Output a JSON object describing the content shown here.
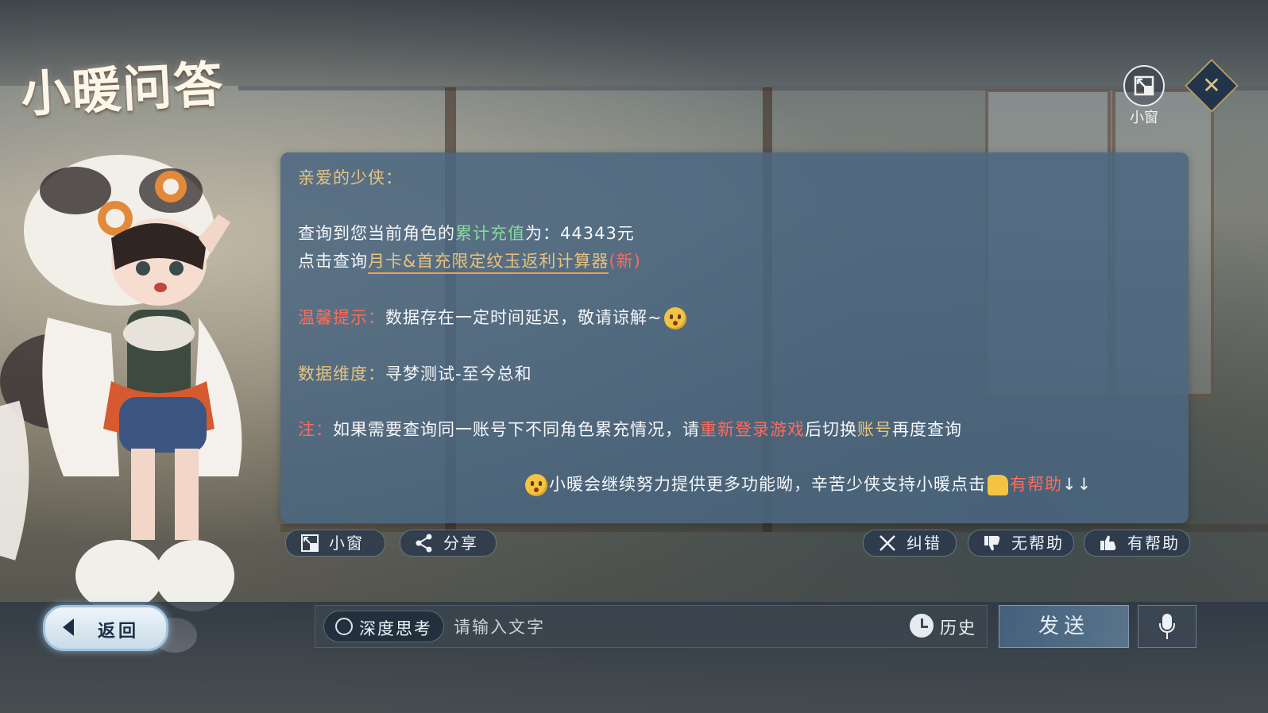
{
  "header": {
    "title": "小暖问答",
    "mini_window_label": "小窗"
  },
  "message": {
    "greeting": "亲爱的少侠：",
    "recharge_prefix": "查询到您当前角色的",
    "recharge_highlight": "累计充值",
    "recharge_suffix": "为：44343元",
    "click_prefix": "点击查询",
    "calculator_link": "月卡&首充限定纹玉返利计算器",
    "calculator_new": "(新)",
    "tip_label": "温馨提示：",
    "tip_text": "数据存在一定时间延迟，敬请谅解~",
    "dimension_label": "数据维度：",
    "dimension_text": "寻梦测试-至今总和",
    "note_label": "注：",
    "note_prefix": "如果需要查询同一账号下不同角色累充情况，请",
    "note_relogin": "重新登录游戏",
    "note_mid": "后切换",
    "note_account": "账号",
    "note_suffix": "再度查询",
    "closing_text": "小暖会继续努力提供更多功能呦，辛苦少侠支持小暖点击",
    "closing_helpful": "有帮助",
    "closing_arrows": "↓↓"
  },
  "actions": {
    "mini_window": "小窗",
    "share": "分享",
    "correct": "纠错",
    "not_helpful": "无帮助",
    "helpful": "有帮助"
  },
  "bottom": {
    "back": "返回",
    "deep_think": "深度思考",
    "input_placeholder": "请输入文字",
    "history": "历史",
    "send": "发送"
  },
  "icons": [
    "mini-window-icon",
    "close-icon",
    "share-icon",
    "correct-x-icon",
    "thumbs-down-icon",
    "thumbs-up-icon",
    "back-arrow-icon",
    "clock-icon",
    "microphone-icon",
    "emoji-face-icon"
  ],
  "colors": {
    "gold": "#e9c27f",
    "green": "#8ad7a0",
    "red": "#ff6b5a",
    "panel": "#4a6680"
  }
}
